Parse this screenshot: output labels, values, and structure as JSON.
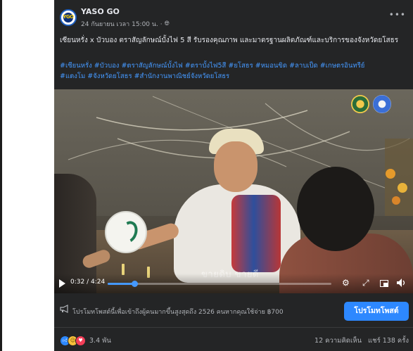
{
  "post": {
    "page_name": "YASO GO",
    "timestamp": "24 กันยายน เวลา 15:00 น. ·",
    "avatar_text": "YGO",
    "caption": "เซียนหรั่ง x บัวบอง ตราสัญลักษณ์บั้งไฟ 5 สี รับรองคุณภาพ และมาตรฐานผลิตภัณฑ์และบริการของจังหวัดยโสธร",
    "hashtags_line1": "#เซียนหรั่ง #บัวบอง #ตราสัญลักษณ์บั้งไฟ #ตราบั้งไฟ5สี #ยโสธร #หมอนขิด #ลาบเป็ด #เกษตรอินทรีย์",
    "hashtags_line2": "#แตงโม #จังหวัดยโสธร #สำนักงานพาณิชย์จังหวัดยโสธร"
  },
  "video": {
    "subtitle": "ขายดิบ ขายดี",
    "time": "0:32 / 4:24",
    "progress": 0.121
  },
  "promote": {
    "text": "โปรโมทโพสต์นี้เพื่อเข้าถึงผู้คนมากขึ้นสูงสุดถึง 2526 คนหากคุณใช้จ่าย ฿700",
    "button_label": "โปรโมทโพสต์"
  },
  "stats": {
    "reaction_count": "3.4 พัน",
    "comments": "12 ความคิดเห็น",
    "shares": "แชร์ 138 ครั้ง"
  },
  "icons": {
    "more": "more-icon",
    "globe": "globe-icon",
    "play": "play-icon",
    "settings": "gear-icon",
    "fullscreen": "fullscreen-icon",
    "pip": "picture-in-picture-icon",
    "volume": "volume-icon",
    "megaphone": "megaphone-icon"
  },
  "colors": {
    "card_bg": "#242526",
    "accent": "#2d88ff",
    "hashtag": "#4599ff",
    "text": "#e4e6eb",
    "muted": "#b0b3b8"
  }
}
